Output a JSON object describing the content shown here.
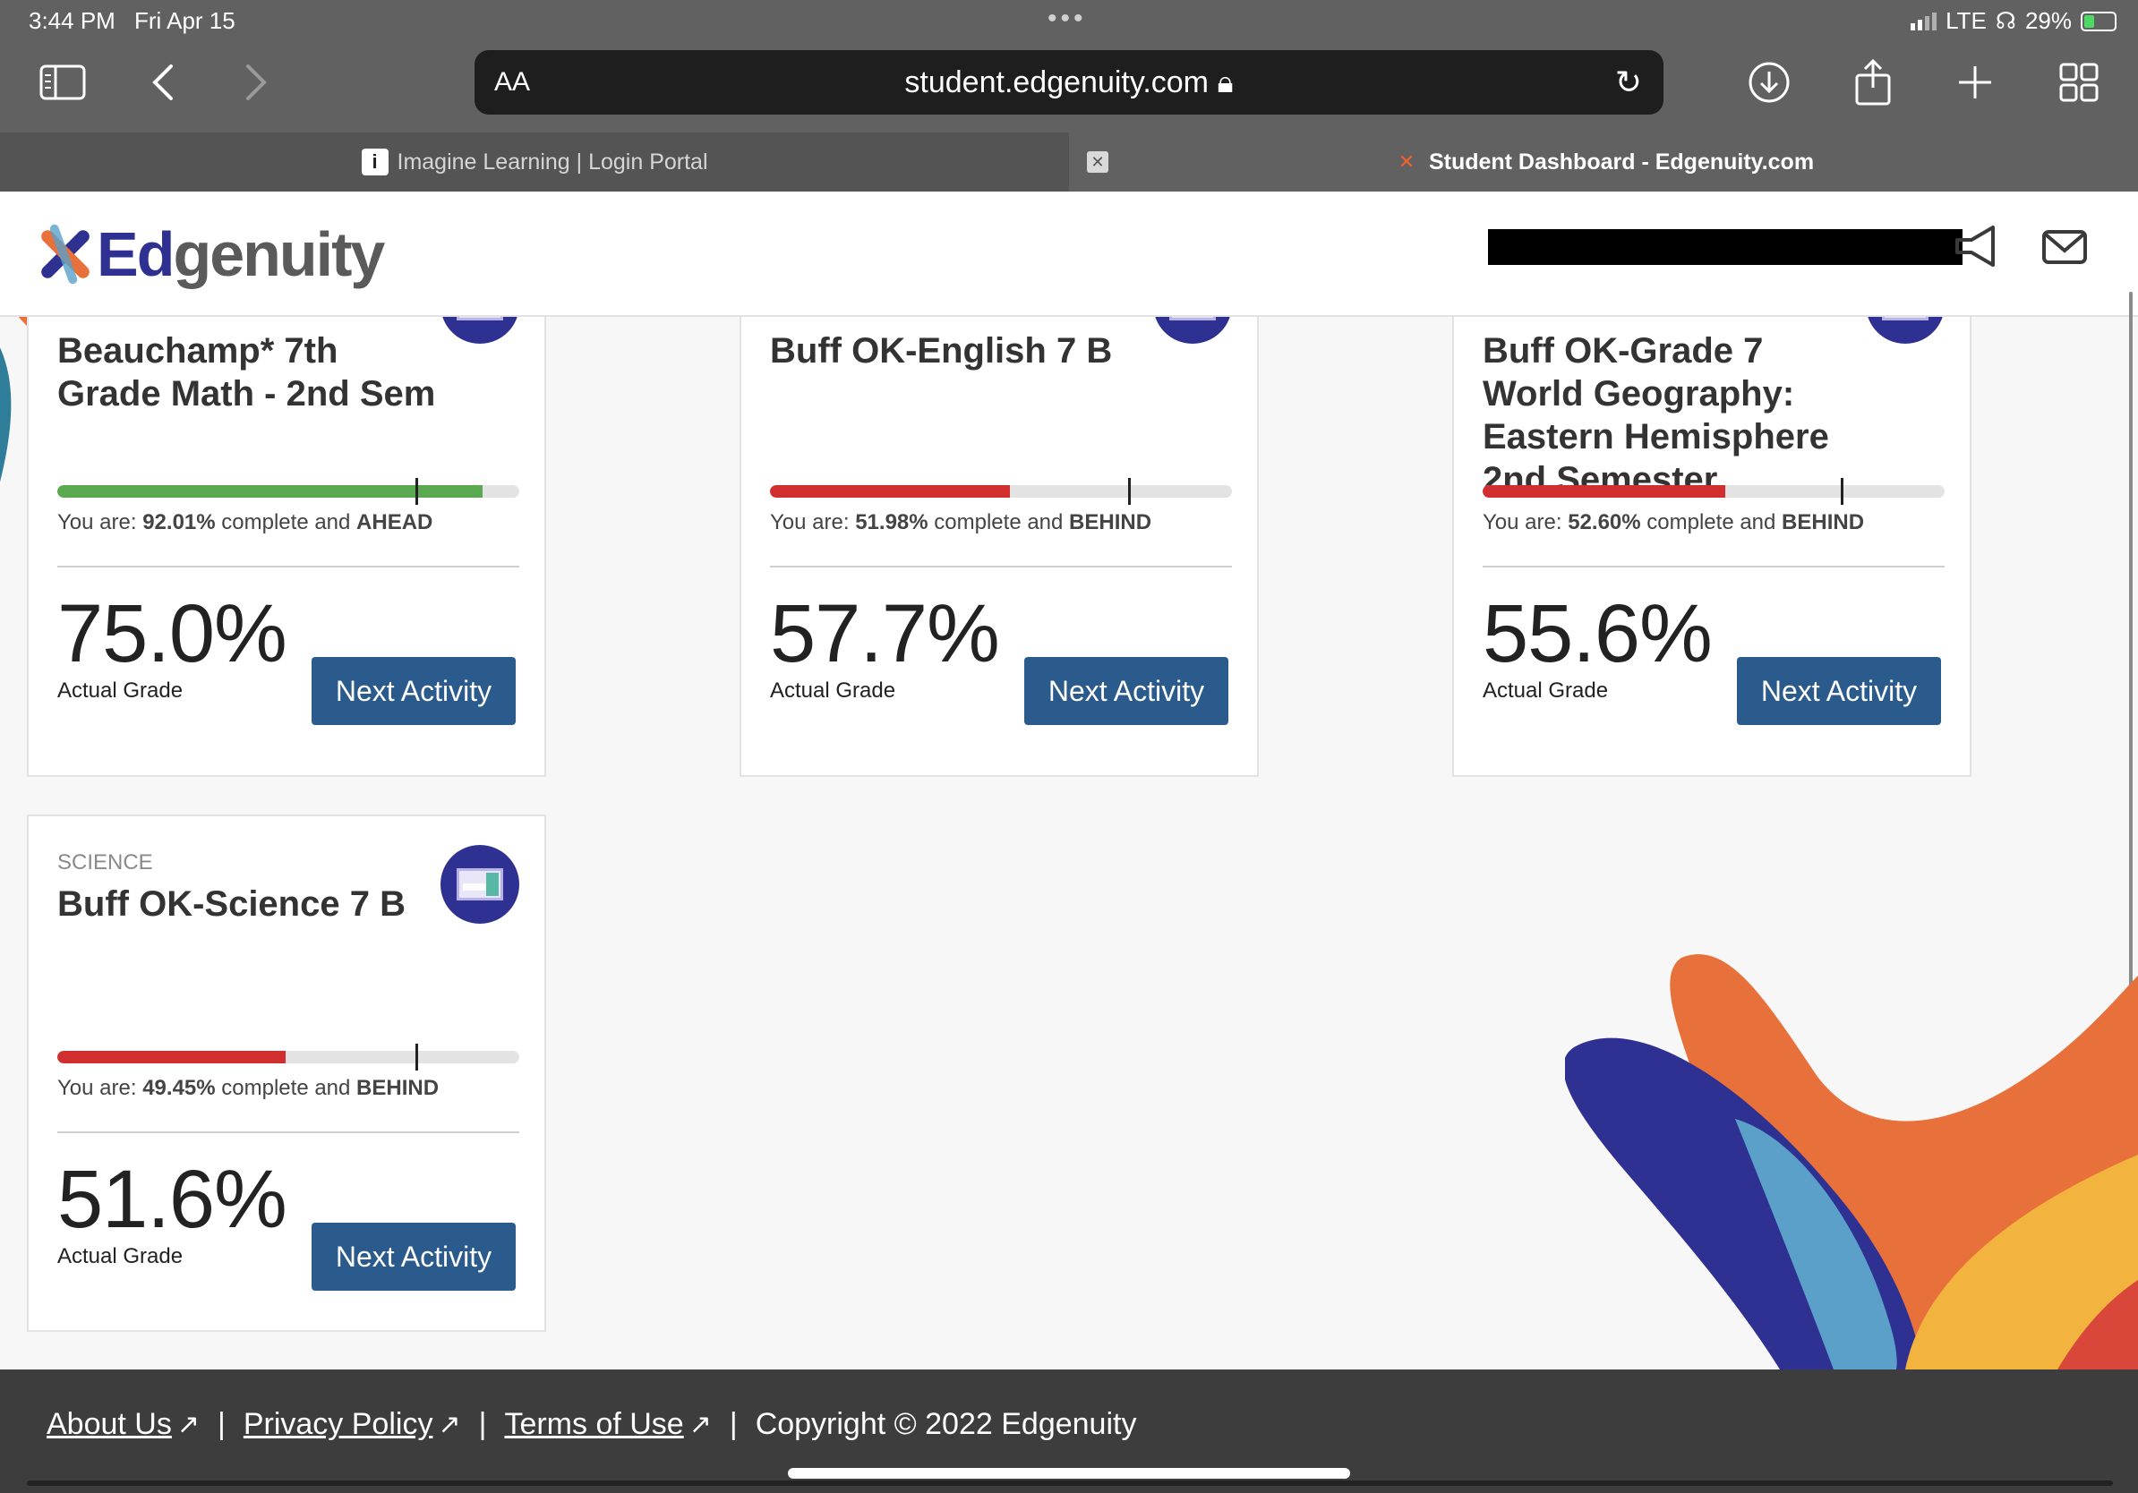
{
  "status_bar": {
    "time": "3:44 PM",
    "date": "Fri Apr 15",
    "network": "LTE",
    "battery": "29%"
  },
  "browser": {
    "text_size_label": "AA",
    "url": "student.edgenuity.com",
    "tabs": [
      {
        "label": "Imagine Learning | Login Portal",
        "active": false
      },
      {
        "label": "Student Dashboard - Edgenuity.com",
        "active": true
      }
    ]
  },
  "header": {
    "logo_ed": "Ed",
    "logo_genuity": "genuity"
  },
  "courses": [
    {
      "subject": "",
      "title": "Beauchamp* 7th Grade Math - 2nd Sem",
      "status_prefix": "You are: ",
      "percent_complete": "92.01%",
      "status_mid": " complete and ",
      "pace": "AHEAD",
      "progress_fraction": 0.9201,
      "target_fraction": 0.78,
      "progress_color": "#5aa950",
      "grade": "75.0%",
      "grade_label": "Actual Grade",
      "button": "Next Activity"
    },
    {
      "subject": "",
      "title": "Buff OK-English 7 B",
      "status_prefix": "You are: ",
      "percent_complete": "51.98%",
      "status_mid": " complete and ",
      "pace": "BEHIND",
      "progress_fraction": 0.5198,
      "target_fraction": 0.78,
      "progress_color": "#d12f2f",
      "grade": "57.7%",
      "grade_label": "Actual Grade",
      "button": "Next Activity"
    },
    {
      "subject": "",
      "title": "Buff OK-Grade 7 World Geography: Eastern Hemisphere 2nd Semester",
      "status_prefix": "You are: ",
      "percent_complete": "52.60%",
      "status_mid": " complete and ",
      "pace": "BEHIND",
      "progress_fraction": 0.526,
      "target_fraction": 0.78,
      "progress_color": "#d12f2f",
      "grade": "55.6%",
      "grade_label": "Actual Grade",
      "button": "Next Activity"
    },
    {
      "subject": "SCIENCE",
      "title": "Buff OK-Science 7 B",
      "status_prefix": "You are: ",
      "percent_complete": "49.45%",
      "status_mid": " complete and ",
      "pace": "BEHIND",
      "progress_fraction": 0.4945,
      "target_fraction": 0.78,
      "progress_color": "#d12f2f",
      "grade": "51.6%",
      "grade_label": "Actual Grade",
      "button": "Next Activity"
    }
  ],
  "footer": {
    "about": "About Us",
    "privacy": "Privacy Policy",
    "terms": "Terms of Use",
    "separator": "|",
    "copyright": "Copyright © 2022 Edgenuity"
  },
  "colors": {
    "brand_navy": "#2e3192",
    "button_blue": "#2a5b8c",
    "ahead_green": "#5aa950",
    "behind_red": "#d12f2f",
    "brand_orange": "#e8703a"
  }
}
